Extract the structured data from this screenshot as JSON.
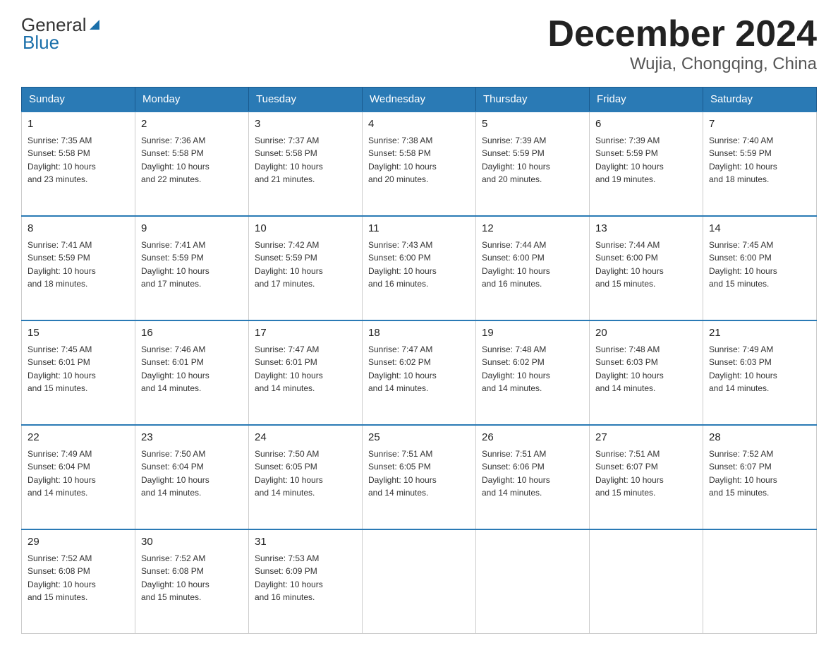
{
  "header": {
    "logo_general": "General",
    "logo_blue": "Blue",
    "month_title": "December 2024",
    "location": "Wujia, Chongqing, China"
  },
  "days_of_week": [
    "Sunday",
    "Monday",
    "Tuesday",
    "Wednesday",
    "Thursday",
    "Friday",
    "Saturday"
  ],
  "weeks": [
    [
      {
        "day": "1",
        "sunrise": "7:35 AM",
        "sunset": "5:58 PM",
        "daylight": "10 hours and 23 minutes."
      },
      {
        "day": "2",
        "sunrise": "7:36 AM",
        "sunset": "5:58 PM",
        "daylight": "10 hours and 22 minutes."
      },
      {
        "day": "3",
        "sunrise": "7:37 AM",
        "sunset": "5:58 PM",
        "daylight": "10 hours and 21 minutes."
      },
      {
        "day": "4",
        "sunrise": "7:38 AM",
        "sunset": "5:58 PM",
        "daylight": "10 hours and 20 minutes."
      },
      {
        "day": "5",
        "sunrise": "7:39 AM",
        "sunset": "5:59 PM",
        "daylight": "10 hours and 20 minutes."
      },
      {
        "day": "6",
        "sunrise": "7:39 AM",
        "sunset": "5:59 PM",
        "daylight": "10 hours and 19 minutes."
      },
      {
        "day": "7",
        "sunrise": "7:40 AM",
        "sunset": "5:59 PM",
        "daylight": "10 hours and 18 minutes."
      }
    ],
    [
      {
        "day": "8",
        "sunrise": "7:41 AM",
        "sunset": "5:59 PM",
        "daylight": "10 hours and 18 minutes."
      },
      {
        "day": "9",
        "sunrise": "7:41 AM",
        "sunset": "5:59 PM",
        "daylight": "10 hours and 17 minutes."
      },
      {
        "day": "10",
        "sunrise": "7:42 AM",
        "sunset": "5:59 PM",
        "daylight": "10 hours and 17 minutes."
      },
      {
        "day": "11",
        "sunrise": "7:43 AM",
        "sunset": "6:00 PM",
        "daylight": "10 hours and 16 minutes."
      },
      {
        "day": "12",
        "sunrise": "7:44 AM",
        "sunset": "6:00 PM",
        "daylight": "10 hours and 16 minutes."
      },
      {
        "day": "13",
        "sunrise": "7:44 AM",
        "sunset": "6:00 PM",
        "daylight": "10 hours and 15 minutes."
      },
      {
        "day": "14",
        "sunrise": "7:45 AM",
        "sunset": "6:00 PM",
        "daylight": "10 hours and 15 minutes."
      }
    ],
    [
      {
        "day": "15",
        "sunrise": "7:45 AM",
        "sunset": "6:01 PM",
        "daylight": "10 hours and 15 minutes."
      },
      {
        "day": "16",
        "sunrise": "7:46 AM",
        "sunset": "6:01 PM",
        "daylight": "10 hours and 14 minutes."
      },
      {
        "day": "17",
        "sunrise": "7:47 AM",
        "sunset": "6:01 PM",
        "daylight": "10 hours and 14 minutes."
      },
      {
        "day": "18",
        "sunrise": "7:47 AM",
        "sunset": "6:02 PM",
        "daylight": "10 hours and 14 minutes."
      },
      {
        "day": "19",
        "sunrise": "7:48 AM",
        "sunset": "6:02 PM",
        "daylight": "10 hours and 14 minutes."
      },
      {
        "day": "20",
        "sunrise": "7:48 AM",
        "sunset": "6:03 PM",
        "daylight": "10 hours and 14 minutes."
      },
      {
        "day": "21",
        "sunrise": "7:49 AM",
        "sunset": "6:03 PM",
        "daylight": "10 hours and 14 minutes."
      }
    ],
    [
      {
        "day": "22",
        "sunrise": "7:49 AM",
        "sunset": "6:04 PM",
        "daylight": "10 hours and 14 minutes."
      },
      {
        "day": "23",
        "sunrise": "7:50 AM",
        "sunset": "6:04 PM",
        "daylight": "10 hours and 14 minutes."
      },
      {
        "day": "24",
        "sunrise": "7:50 AM",
        "sunset": "6:05 PM",
        "daylight": "10 hours and 14 minutes."
      },
      {
        "day": "25",
        "sunrise": "7:51 AM",
        "sunset": "6:05 PM",
        "daylight": "10 hours and 14 minutes."
      },
      {
        "day": "26",
        "sunrise": "7:51 AM",
        "sunset": "6:06 PM",
        "daylight": "10 hours and 14 minutes."
      },
      {
        "day": "27",
        "sunrise": "7:51 AM",
        "sunset": "6:07 PM",
        "daylight": "10 hours and 15 minutes."
      },
      {
        "day": "28",
        "sunrise": "7:52 AM",
        "sunset": "6:07 PM",
        "daylight": "10 hours and 15 minutes."
      }
    ],
    [
      {
        "day": "29",
        "sunrise": "7:52 AM",
        "sunset": "6:08 PM",
        "daylight": "10 hours and 15 minutes."
      },
      {
        "day": "30",
        "sunrise": "7:52 AM",
        "sunset": "6:08 PM",
        "daylight": "10 hours and 15 minutes."
      },
      {
        "day": "31",
        "sunrise": "7:53 AM",
        "sunset": "6:09 PM",
        "daylight": "10 hours and 16 minutes."
      },
      null,
      null,
      null,
      null
    ]
  ],
  "labels": {
    "sunrise": "Sunrise:",
    "sunset": "Sunset:",
    "daylight": "Daylight:"
  }
}
